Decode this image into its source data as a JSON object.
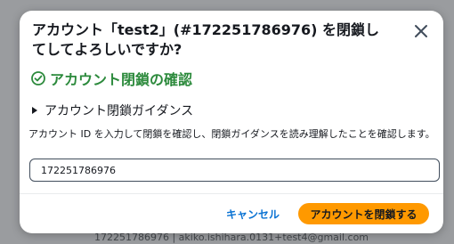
{
  "background": {
    "top_left_text": "",
    "footer_text": "172251786976 | akiko.ishihara.0131+test4@gmail.com"
  },
  "modal": {
    "title": "アカウント「test2」(#172251786976) を閉鎖してしてよろしいですか?",
    "close_icon": "close-x-icon",
    "confirm_heading": "アカウント閉鎖の確認",
    "confirm_icon": "check-circle-icon",
    "disclosure_label": "アカウント閉鎖ガイダンス",
    "disclosure_icon": "caret-right-icon",
    "instruction": "アカウント ID を入力して閉鎖を確認し、閉鎖ガイダンスを読み理解したことを確認します。",
    "input_value": "172251786976",
    "cancel_label": "キャンセル",
    "submit_label": "アカウントを閉鎖する"
  },
  "colors": {
    "success": "#2c8a3c",
    "primary_button": "#ff9900",
    "link": "#0972d3",
    "text": "#16191f"
  }
}
